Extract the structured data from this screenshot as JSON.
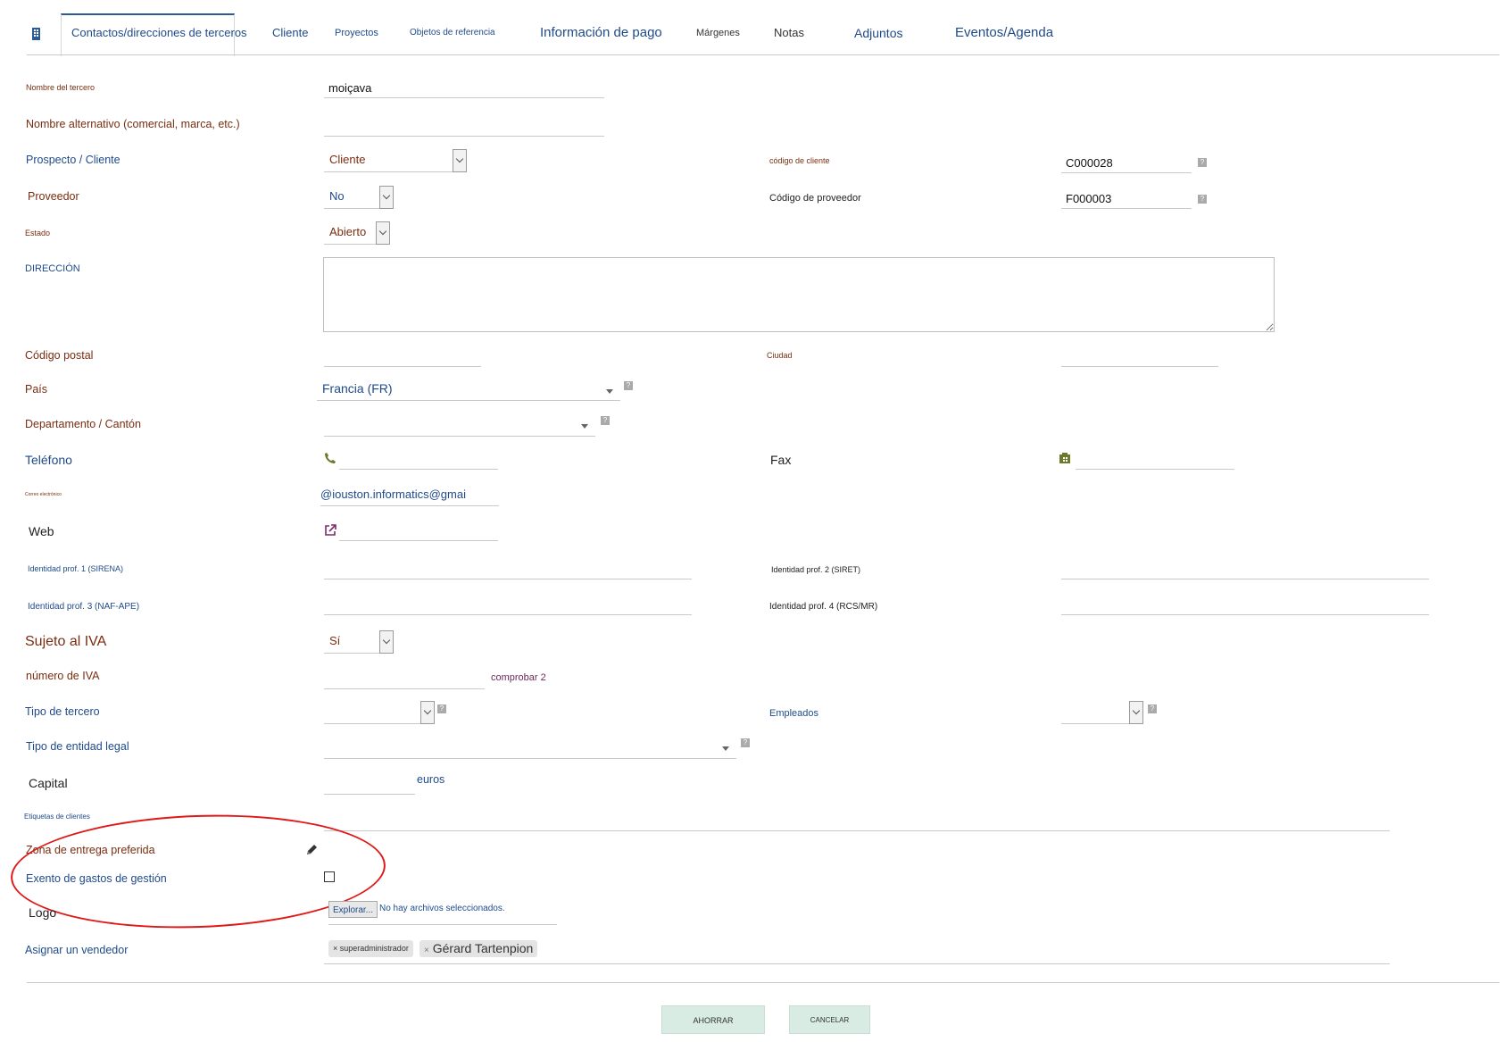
{
  "tabs": [
    {
      "label": "Contactos/direcciones de terceros"
    },
    {
      "label": "Cliente"
    },
    {
      "label": "Proyectos"
    },
    {
      "label": "Objetos de referencia"
    },
    {
      "label": "Información de pago"
    },
    {
      "label": "Márgenes"
    },
    {
      "label": "Notas"
    },
    {
      "label": "Adjuntos"
    },
    {
      "label": "Eventos/Agenda"
    }
  ],
  "form": {
    "name": {
      "label": "Nombre del tercero",
      "value": "moiçava"
    },
    "alt_name": {
      "label": "Nombre alternativo (comercial, marca, etc.)",
      "value": ""
    },
    "prospect": {
      "label": "Prospecto / Cliente",
      "value": "Cliente"
    },
    "customer_code": {
      "label": "código de cliente",
      "value": "C000028"
    },
    "supplier": {
      "label": "Proveedor",
      "value": "No"
    },
    "supplier_code": {
      "label": "Código de proveedor",
      "value": "F000003"
    },
    "status": {
      "label": "Estado",
      "value": "Abierto"
    },
    "address": {
      "label": "DIRECCIÓN"
    },
    "zip": {
      "label": "Código postal"
    },
    "town": {
      "label": "Ciudad"
    },
    "country": {
      "label": "País",
      "value": "Francia (FR)"
    },
    "state": {
      "label": "Departamento / Cantón"
    },
    "phone": {
      "label": "Teléfono"
    },
    "fax": {
      "label": "Fax"
    },
    "email": {
      "label": "Correo electrónico",
      "value": "@iouston.informatics@gmai"
    },
    "web": {
      "label": "Web"
    },
    "prof1": {
      "label": "Identidad prof. 1 (SIRENA)"
    },
    "prof2": {
      "label": "Identidad prof. 2 (SIRET)"
    },
    "prof3": {
      "label": "Identidad prof. 3 (NAF-APE)"
    },
    "prof4": {
      "label": "Identidad prof. 4 (RCS/MR)"
    },
    "vat_subject": {
      "label": "Sujeto al IVA",
      "value": "Sí"
    },
    "vat_number": {
      "label": "número de IVA",
      "check": "comprobar 2"
    },
    "thirdparty_type": {
      "label": "Tipo de tercero"
    },
    "employees": {
      "label": "Empleados"
    },
    "legal_form": {
      "label": "Tipo de entidad legal"
    },
    "capital": {
      "label": "Capital",
      "unit": "euros"
    },
    "tags": {
      "label": "Etiquetas de clientes"
    },
    "delivery_zone": {
      "label": "Zona de entrega preferida"
    },
    "exempt": {
      "label": "Exento de gastos de gestión"
    },
    "logo": {
      "label": "Logo",
      "button": "Explorar...",
      "nofile": "No hay archivos seleccionados."
    },
    "salesrep": {
      "label": "Asignar un vendedor",
      "chips": [
        "superadministrador",
        "Gérard Tartenpion"
      ]
    }
  },
  "actions": {
    "save": "AHORRAR",
    "cancel": "CANCELAR"
  },
  "help_glyph": "?",
  "accent_color": "#2b5a9a",
  "highlight_color": "#e01818"
}
